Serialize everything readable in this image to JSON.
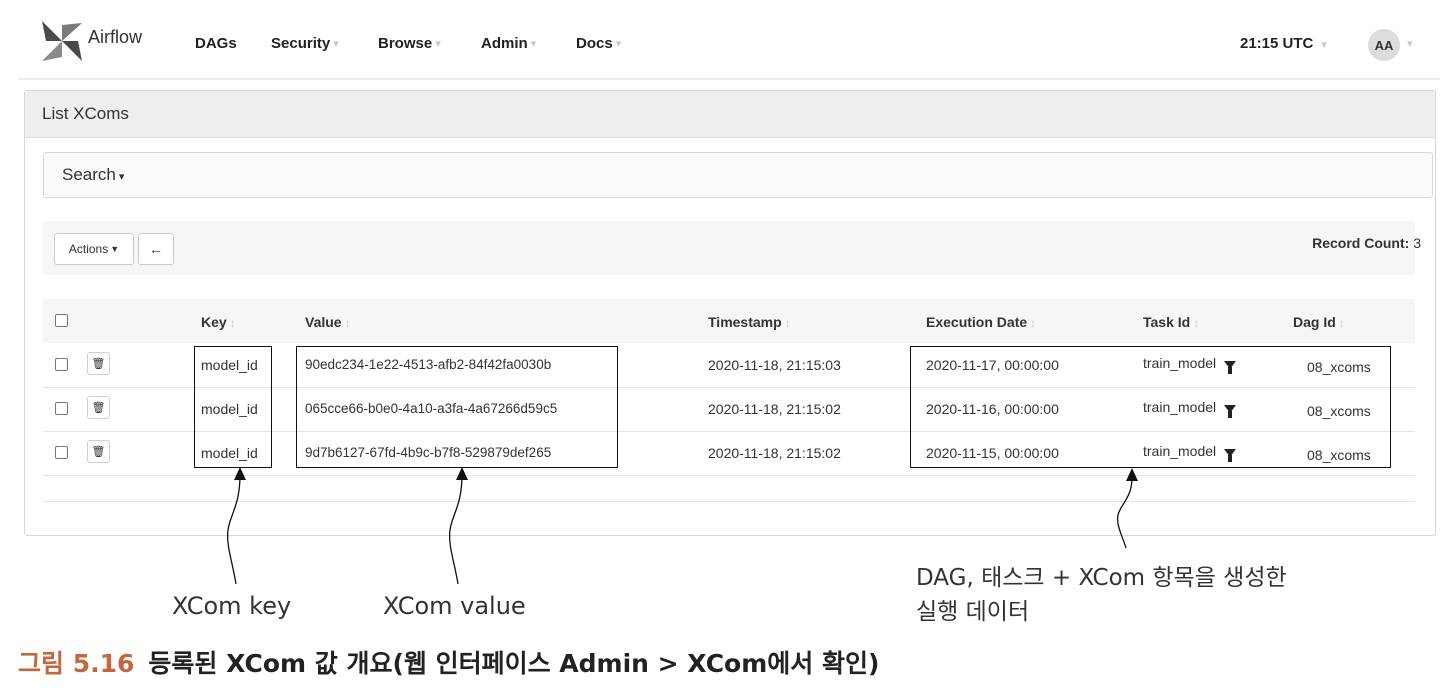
{
  "navbar": {
    "brand": "Airflow",
    "items": [
      {
        "label": "DAGs",
        "has_caret": false
      },
      {
        "label": "Security",
        "has_caret": true
      },
      {
        "label": "Browse",
        "has_caret": true
      },
      {
        "label": "Admin",
        "has_caret": true
      },
      {
        "label": "Docs",
        "has_caret": true
      }
    ],
    "clock": "21:15 UTC",
    "avatar": "AA"
  },
  "panel": {
    "title": "List XComs",
    "search_label": "Search",
    "actions_label": "Actions",
    "record_count_label": "Record Count:",
    "record_count": "3"
  },
  "table": {
    "columns": [
      "Key",
      "Value",
      "Timestamp",
      "Execution Date",
      "Task Id",
      "Dag Id"
    ],
    "rows": [
      {
        "key": "model_id",
        "value": "90edc234-1e22-4513-afb2-84f42fa0030b",
        "timestamp": "2020-11-18, 21:15:03",
        "execution_date": "2020-11-17, 00:00:00",
        "task_id": "train_model",
        "dag_id": "08_xcoms"
      },
      {
        "key": "model_id",
        "value": "065cce66-b0e0-4a10-a3fa-4a67266d59c5",
        "timestamp": "2020-11-18, 21:15:02",
        "execution_date": "2020-11-16, 00:00:00",
        "task_id": "train_model",
        "dag_id": "08_xcoms"
      },
      {
        "key": "model_id",
        "value": "9d7b6127-67fd-4b9c-b7f8-529879def265",
        "timestamp": "2020-11-18, 21:15:02",
        "execution_date": "2020-11-15, 00:00:00",
        "task_id": "train_model",
        "dag_id": "08_xcoms"
      }
    ]
  },
  "annotations": {
    "xcom_key": "XCom key",
    "xcom_value": "XCom value",
    "run_data_line1": "DAG, 태스크 + XCom 항목을 생성한",
    "run_data_line2": "실행 데이터"
  },
  "caption": {
    "figure": "그림 5.16",
    "text": "등록된 XCom 값 개요(웹 인터페이스 Admin > XCom에서 확인)"
  }
}
